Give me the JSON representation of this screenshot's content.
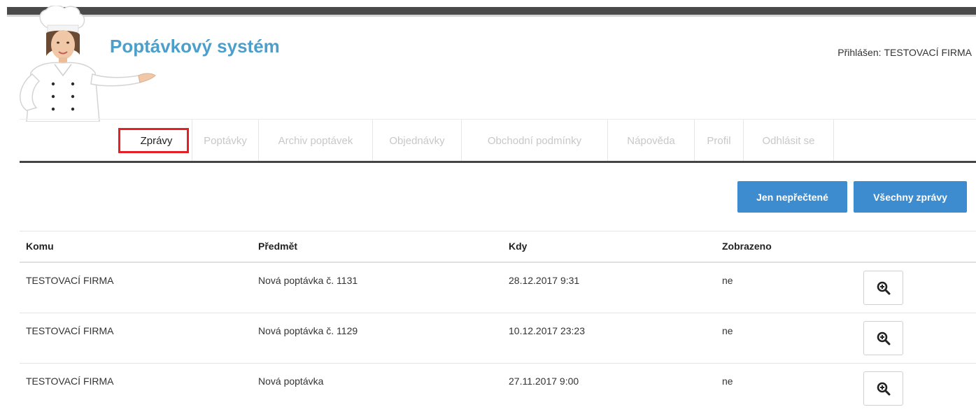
{
  "header": {
    "site_title": "Poptávkový systém",
    "logged_in_label": "Přihlášen:",
    "logged_in_user": "TESTOVACÍ FIRMA"
  },
  "menu": {
    "items": [
      {
        "label": "Zprávy",
        "active": true
      },
      {
        "label": "Poptávky",
        "active": false
      },
      {
        "label": "Archiv poptávek",
        "active": false
      },
      {
        "label": "Objednávky",
        "active": false
      },
      {
        "label": "Obchodní podmínky",
        "active": false
      },
      {
        "label": "Nápověda",
        "active": false
      },
      {
        "label": "Profil",
        "active": false
      },
      {
        "label": "Odhlásit se",
        "active": false
      }
    ]
  },
  "actions": {
    "unread_label": "Jen nepřečtené",
    "all_label": "Všechny zprávy"
  },
  "table": {
    "columns": [
      "Komu",
      "Předmět",
      "Kdy",
      "Zobrazeno"
    ],
    "rows": [
      {
        "komu": "TESTOVACÍ FIRMA",
        "predmet": "Nová poptávka č. 1131",
        "kdy": "28.12.2017 9:31",
        "zobrazeno": "ne"
      },
      {
        "komu": "TESTOVACÍ FIRMA",
        "predmet": "Nová poptávka č. 1129",
        "kdy": "10.12.2017 23:23",
        "zobrazeno": "ne"
      },
      {
        "komu": "TESTOVACÍ FIRMA",
        "predmet": "Nová poptávka",
        "kdy": "27.11.2017 9:00",
        "zobrazeno": "ne"
      }
    ]
  },
  "icons": {
    "view": "zoom-in-icon",
    "logo": "chef-illustration"
  },
  "colors": {
    "title": "#4d9fcb",
    "button": "#3c8ccf",
    "active_outline": "#e41f26",
    "menu_inactive": "#c8c8c8"
  }
}
